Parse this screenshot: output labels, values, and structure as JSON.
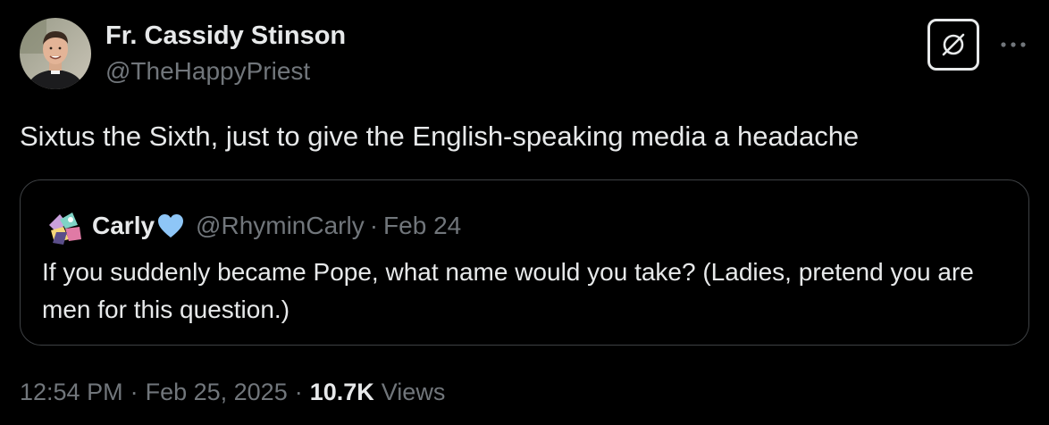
{
  "author": {
    "name": "Fr. Cassidy Stinson",
    "handle": "@TheHappyPriest"
  },
  "tweet": {
    "text": "Sixtus the Sixth, just to give the English-speaking media a headache"
  },
  "quoted_tweet": {
    "name": "Carly",
    "handle": "@RhyminCarly",
    "separator": "·",
    "date": "Feb 24",
    "text": "If you suddenly became Pope, what name would you take? (Ladies, pretend you are men for this question.)",
    "badge_icon": "blue-heart-icon"
  },
  "meta": {
    "time": "12:54 PM",
    "separator1": "·",
    "date": "Feb 25, 2025",
    "separator2": "·",
    "views_count": "10.7K",
    "views_label": "Views"
  },
  "icons": {
    "grok": "grok-icon",
    "more": "more-horizontal-icon"
  },
  "colors": {
    "background": "#000000",
    "primary_text": "#e7e9ea",
    "secondary_text": "#71767b",
    "border": "#3e4144",
    "heart": "#8ec6f7"
  }
}
